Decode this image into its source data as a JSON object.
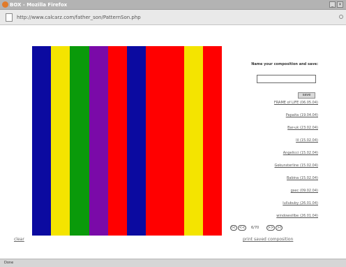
{
  "window": {
    "title": "BOX - Mozilla Firefox",
    "minimize_label": "_",
    "close_label": "×"
  },
  "address": {
    "url": "http://www.calcarz.com/father_son/PatternSon.php"
  },
  "composition": {
    "stripes": [
      {
        "color": "#0b0aa0",
        "weight": 1
      },
      {
        "color": "#f4e400",
        "weight": 1
      },
      {
        "color": "#0a9a0a",
        "weight": 1
      },
      {
        "color": "#7a0aa8",
        "weight": 1
      },
      {
        "color": "#ff0000",
        "weight": 1
      },
      {
        "color": "#0b0aa0",
        "weight": 1
      },
      {
        "color": "#ff0000",
        "weight": 2
      },
      {
        "color": "#f4e400",
        "weight": 1
      },
      {
        "color": "#ff0000",
        "weight": 1
      }
    ]
  },
  "save_form": {
    "label": "Name your composition and save:",
    "input_value": "",
    "save_label": "save"
  },
  "saved_compositions": [
    "FRAME of LIFE (06.05.04)",
    "Papaita (19.04.04)",
    "Bar-uk (23.02.04)",
    "lil (15.02.04)",
    "Angelicci (15.02.04)",
    "Gekunsterline (15.02.04)",
    "Babina (15.02.04)",
    "gsec (09.02.04)",
    "lullububy (26.01.04)",
    "windowsillbe (26.01.04)"
  ],
  "pager": {
    "first": "I<",
    "prev": "<<",
    "count": "6/70",
    "next": ">>",
    "last": ">I"
  },
  "links": {
    "clear": "clear",
    "print": "print saved composition"
  },
  "status": {
    "text": "Done"
  }
}
